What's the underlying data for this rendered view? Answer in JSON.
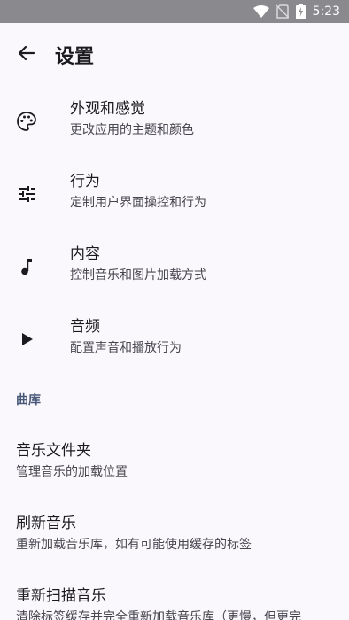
{
  "status_bar": {
    "time": "5:23",
    "icons": [
      "wifi-icon",
      "no-sim-icon",
      "battery-charging-icon"
    ]
  },
  "app_bar": {
    "title": "设置",
    "back_icon": "arrow-back-icon"
  },
  "settings": [
    {
      "icon": "palette-icon",
      "label": "外观和感觉",
      "summary": "更改应用的主题和颜色"
    },
    {
      "icon": "tune-icon",
      "label": "行为",
      "summary": "定制用户界面操控和行为"
    },
    {
      "icon": "music-note-icon",
      "label": "内容",
      "summary": "控制音乐和图片加载方式"
    },
    {
      "icon": "play-icon",
      "label": "音频",
      "summary": "配置声音和播放行为"
    }
  ],
  "library": {
    "header": "曲库",
    "items": [
      {
        "label": "音乐文件夹",
        "summary": "管理音乐的加载位置"
      },
      {
        "label": "刷新音乐",
        "summary": "重新加载音乐库，如有可能使用缓存的标签"
      },
      {
        "label": "重新扫描音乐",
        "summary": "清除标签缓存并完全重新加载音乐库（更慢，但更完"
      }
    ]
  },
  "colors": {
    "background": "#fbf8fd",
    "status_bar": "#8a8a8e",
    "section_header": "#48597a"
  }
}
